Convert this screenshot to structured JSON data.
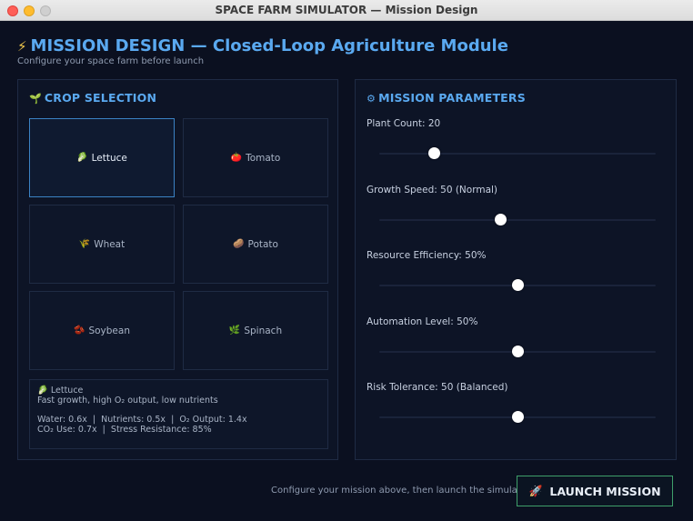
{
  "window": {
    "title": "SPACE FARM SIMULATOR — Mission Design"
  },
  "header": {
    "icon": "lightning-icon",
    "title": "MISSION DESIGN — Closed-Loop Agriculture Module",
    "subtitle": "Configure your space farm before launch"
  },
  "crop_panel": {
    "icon": "sprout-icon",
    "heading": "CROP SELECTION",
    "selected": "Lettuce",
    "crops": [
      {
        "label": "Lettuce",
        "icon": "leaf-icon",
        "glyph": "🥬",
        "selected": true
      },
      {
        "label": "Tomato",
        "icon": "tomato-icon",
        "glyph": "🍅",
        "selected": false
      },
      {
        "label": "Wheat",
        "icon": "wheat-icon",
        "glyph": "🌾",
        "selected": false
      },
      {
        "label": "Potato",
        "icon": "potato-icon",
        "glyph": "🥔",
        "selected": false
      },
      {
        "label": "Soybean",
        "icon": "bean-icon",
        "glyph": "🫘",
        "selected": false
      },
      {
        "label": "Spinach",
        "icon": "spinach-icon",
        "glyph": "🌿",
        "selected": false
      }
    ],
    "info": {
      "icon": "leaf-icon",
      "name": "Lettuce",
      "description": "Fast growth, high O₂ output, low nutrients",
      "stats_line1": "Water: 0.6x  |  Nutrients: 0.5x  |  O₂ Output: 1.4x",
      "stats_line2": "CO₂ Use: 0.7x  |  Stress Resistance: 85%"
    }
  },
  "params_panel": {
    "icon": "gear-icon",
    "heading": "MISSION PARAMETERS",
    "sliders": [
      {
        "label": "Plant Count: 20",
        "fraction": 0.2
      },
      {
        "label": "Growth Speed: 50 (Normal)",
        "fraction": 0.44
      },
      {
        "label": "Resource Efficiency: 50%",
        "fraction": 0.5
      },
      {
        "label": "Automation Level: 50%",
        "fraction": 0.5
      },
      {
        "label": "Risk Tolerance: 50 (Balanced)",
        "fraction": 0.5
      }
    ]
  },
  "footer": {
    "hint": "Configure your mission above, then launch the simulation.",
    "launch_icon": "rocket-icon",
    "launch_label": "LAUNCH MISSION"
  },
  "colors": {
    "background": "#0b1020",
    "accent": "#5aa9f0",
    "selected_border": "#3b82c4",
    "launch_border": "#3f9f6a"
  }
}
